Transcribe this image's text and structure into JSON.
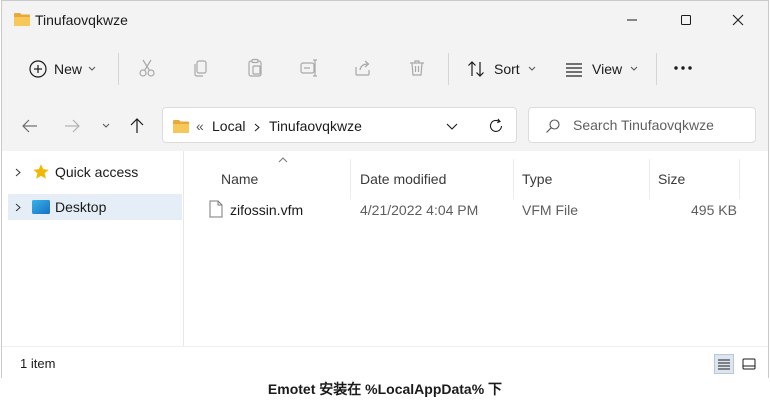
{
  "window": {
    "title": "Tinufaovqkwze"
  },
  "toolbar": {
    "new_label": "New",
    "sort_label": "Sort",
    "view_label": "View"
  },
  "address": {
    "overflow": "«",
    "segments": [
      "Local",
      "Tinufaovqkwze"
    ]
  },
  "search": {
    "placeholder": "Search Tinufaovqkwze"
  },
  "nav": {
    "items": [
      {
        "label": "Quick access"
      },
      {
        "label": "Desktop"
      }
    ]
  },
  "columns": {
    "name": "Name",
    "date": "Date modified",
    "type": "Type",
    "size": "Size"
  },
  "files": [
    {
      "name": "zifossin.vfm",
      "date": "4/21/2022 4:04 PM",
      "type": "VFM File",
      "size": "495 KB"
    }
  ],
  "status": {
    "count": "1 item"
  },
  "caption": "Emotet 安装在 %LocalAppData% 下",
  "colors": {
    "folder": "#f2c14e",
    "accent": "#0067c0",
    "selected": "#e5eef7"
  }
}
